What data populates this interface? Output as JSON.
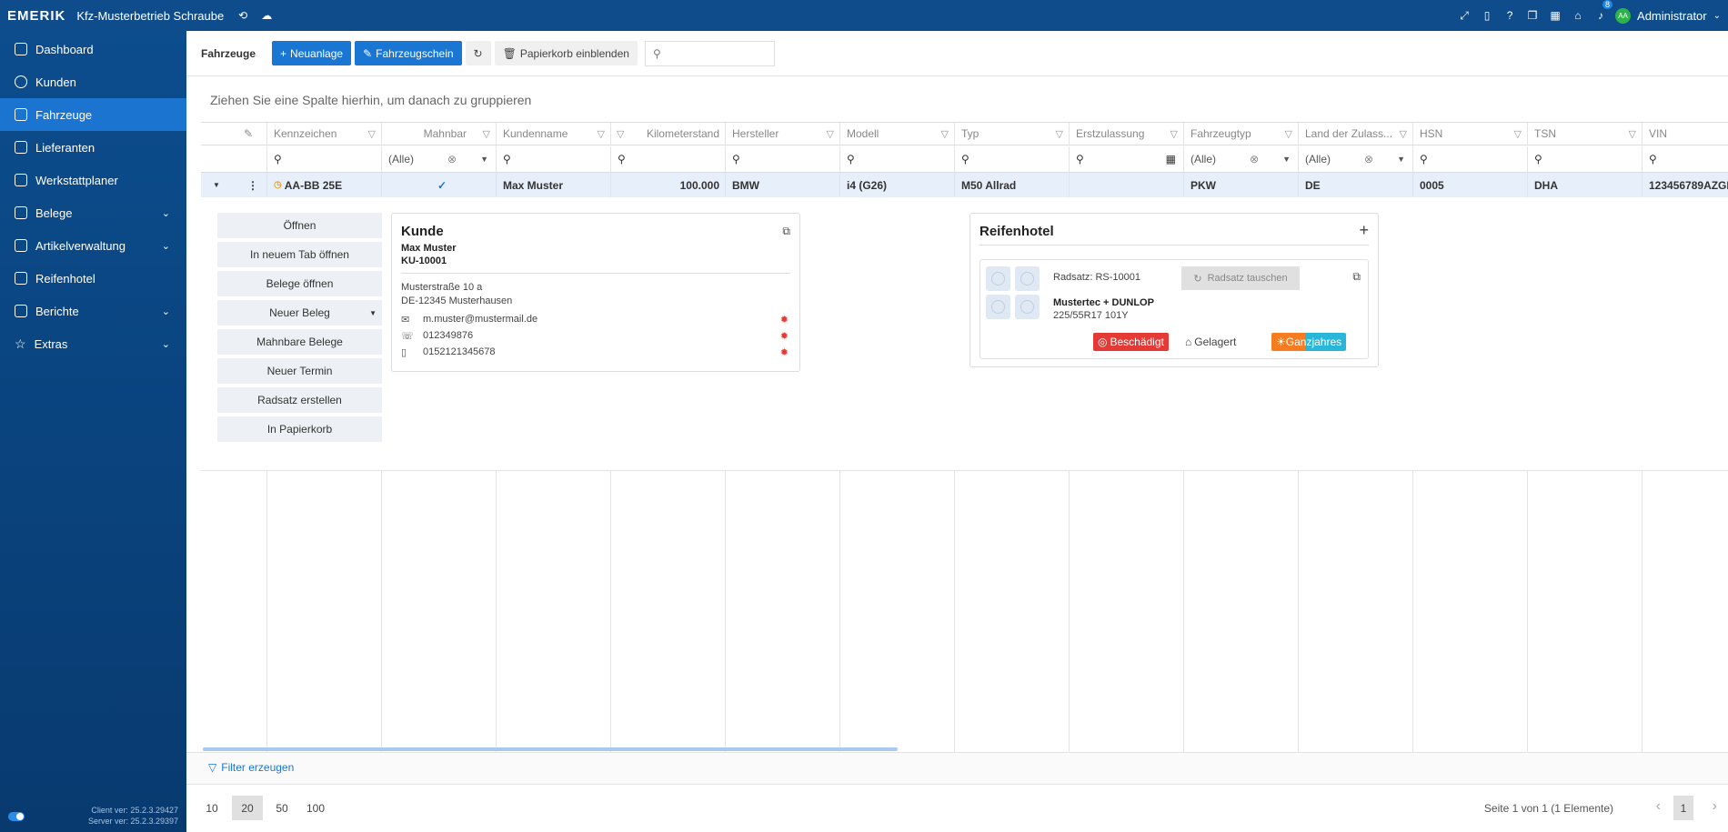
{
  "topbar": {
    "logo": "EMERIK",
    "company": "Kfz-Musterbetrieb Schraube",
    "notifications": "8",
    "user_initials": "AA",
    "user": "Administrator"
  },
  "sidebar": {
    "items": [
      {
        "label": "Dashboard"
      },
      {
        "label": "Kunden"
      },
      {
        "label": "Fahrzeuge"
      },
      {
        "label": "Lieferanten"
      },
      {
        "label": "Werkstattplaner"
      },
      {
        "label": "Belege"
      },
      {
        "label": "Artikelverwaltung"
      },
      {
        "label": "Reifenhotel"
      },
      {
        "label": "Berichte"
      },
      {
        "label": "Extras"
      }
    ],
    "client_version": "Client ver: 25.2.3.29427",
    "server_version": "Server ver: 25.2.3.29397"
  },
  "toolbar": {
    "title": "Fahrzeuge",
    "new_label": "Neuanlage",
    "registration_label": "Fahrzeugschein",
    "trash_label": "Papierkorb einblenden"
  },
  "grid": {
    "group_hint": "Ziehen Sie eine Spalte hierhin, um danach zu gruppieren",
    "headers": [
      "Kennzeichen",
      "Mahnbar",
      "Kundenname",
      "Kilometerstand",
      "Hersteller",
      "Modell",
      "Typ",
      "Erstzulassung",
      "Fahrzeugtyp",
      "Land der Zulass...",
      "HSN",
      "TSN",
      "VIN"
    ],
    "filter_all": "(Alle)",
    "row": {
      "kennzeichen": "AA-BB 25E",
      "kunde": "Max Muster",
      "km": "100.000",
      "hersteller": "BMW",
      "modell": "i4 (G26)",
      "typ": "M50 Allrad",
      "fahrzeugtyp": "PKW",
      "land": "DE",
      "hsn": "0005",
      "tsn": "DHA",
      "vin": "123456789AZGI"
    }
  },
  "actions": [
    "Öffnen",
    "In neuem Tab öffnen",
    "Belege öffnen",
    "Neuer Beleg",
    "Mahnbare Belege",
    "Neuer Termin",
    "Radsatz erstellen",
    "In Papierkorb"
  ],
  "kunde": {
    "title": "Kunde",
    "name": "Max Muster",
    "number": "KU-10001",
    "street": "Musterstraße 10 a",
    "city": "DE-12345 Musterhausen",
    "email": "m.muster@mustermail.de",
    "phone": "012349876",
    "mobile": "0152121345678"
  },
  "reifenhotel": {
    "title": "Reifenhotel",
    "radsatz": "Radsatz: RS-10001",
    "swap_label": "Radsatz tauschen",
    "brand": "Mustertec + DUNLOP",
    "size": "225/55R17 101Y",
    "tag_damaged": "Beschädigt",
    "tag_stored": "Gelagert",
    "tag_season": "Ganzjahres"
  },
  "footer": {
    "filter_label": "Filter erzeugen",
    "page_sizes": [
      "10",
      "20",
      "50",
      "100"
    ],
    "page_info": "Seite 1 von 1 (1 Elemente)",
    "current_page": "1"
  },
  "colors": {
    "sidebar": "#0c4d8e",
    "active": "#1b74cf",
    "primary": "#1976d2",
    "damaged": "#e53935",
    "season": "#f57c20"
  }
}
